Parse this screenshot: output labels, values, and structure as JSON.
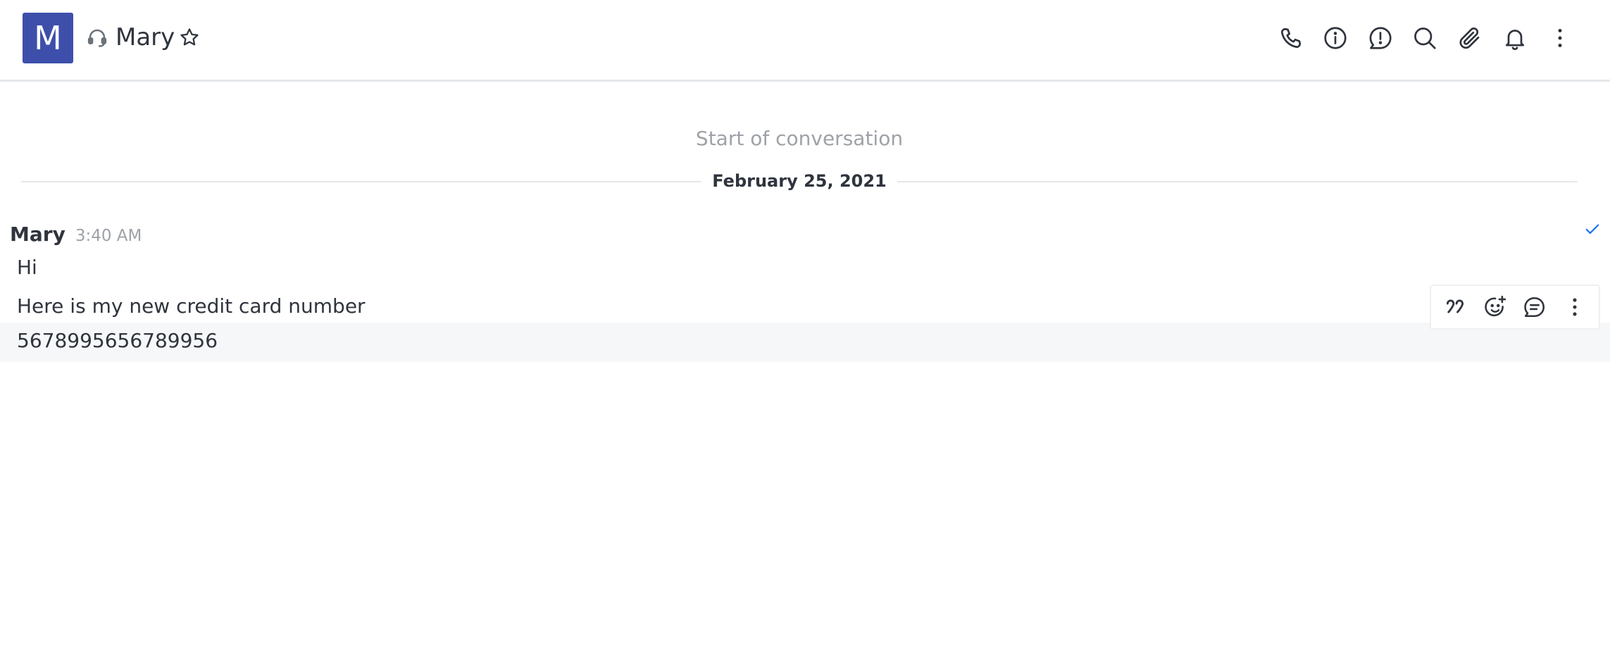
{
  "header": {
    "avatar_initial": "M",
    "avatar_color": "#3e4fab",
    "room_type_icon": "headset-icon",
    "title": "Mary",
    "favorite_icon": "star-icon",
    "toolbar": [
      {
        "name": "call",
        "icon": "phone-icon"
      },
      {
        "name": "room-info",
        "icon": "info-icon"
      },
      {
        "name": "discussion",
        "icon": "discussion-icon"
      },
      {
        "name": "search-messages",
        "icon": "search-icon"
      },
      {
        "name": "files",
        "icon": "paperclip-icon"
      },
      {
        "name": "notifications",
        "icon": "bell-icon"
      },
      {
        "name": "more",
        "icon": "kebab-menu-icon"
      }
    ]
  },
  "conversation": {
    "start_label": "Start of conversation",
    "date_divider": "February 25, 2021",
    "message_group": {
      "author": "Mary",
      "time": "3:40 AM",
      "read_receipt_icon": "check-icon",
      "messages": [
        {
          "text": "Hi"
        },
        {
          "text": "Here is my new credit card number"
        },
        {
          "text": "5678995656789956"
        }
      ]
    },
    "message_actions": [
      {
        "name": "quote",
        "icon": "quote-icon"
      },
      {
        "name": "add-reaction",
        "icon": "add-reaction-icon"
      },
      {
        "name": "reply-in-thread",
        "icon": "thread-icon"
      },
      {
        "name": "more-actions",
        "icon": "kebab-menu-icon"
      }
    ]
  },
  "colors": {
    "accent": "#3e4fab",
    "text": "#2f343d",
    "muted": "#9ea2a8",
    "divider": "#e4e7ea",
    "hover_row": "#f5f7f8",
    "check": "#1d74f5"
  }
}
